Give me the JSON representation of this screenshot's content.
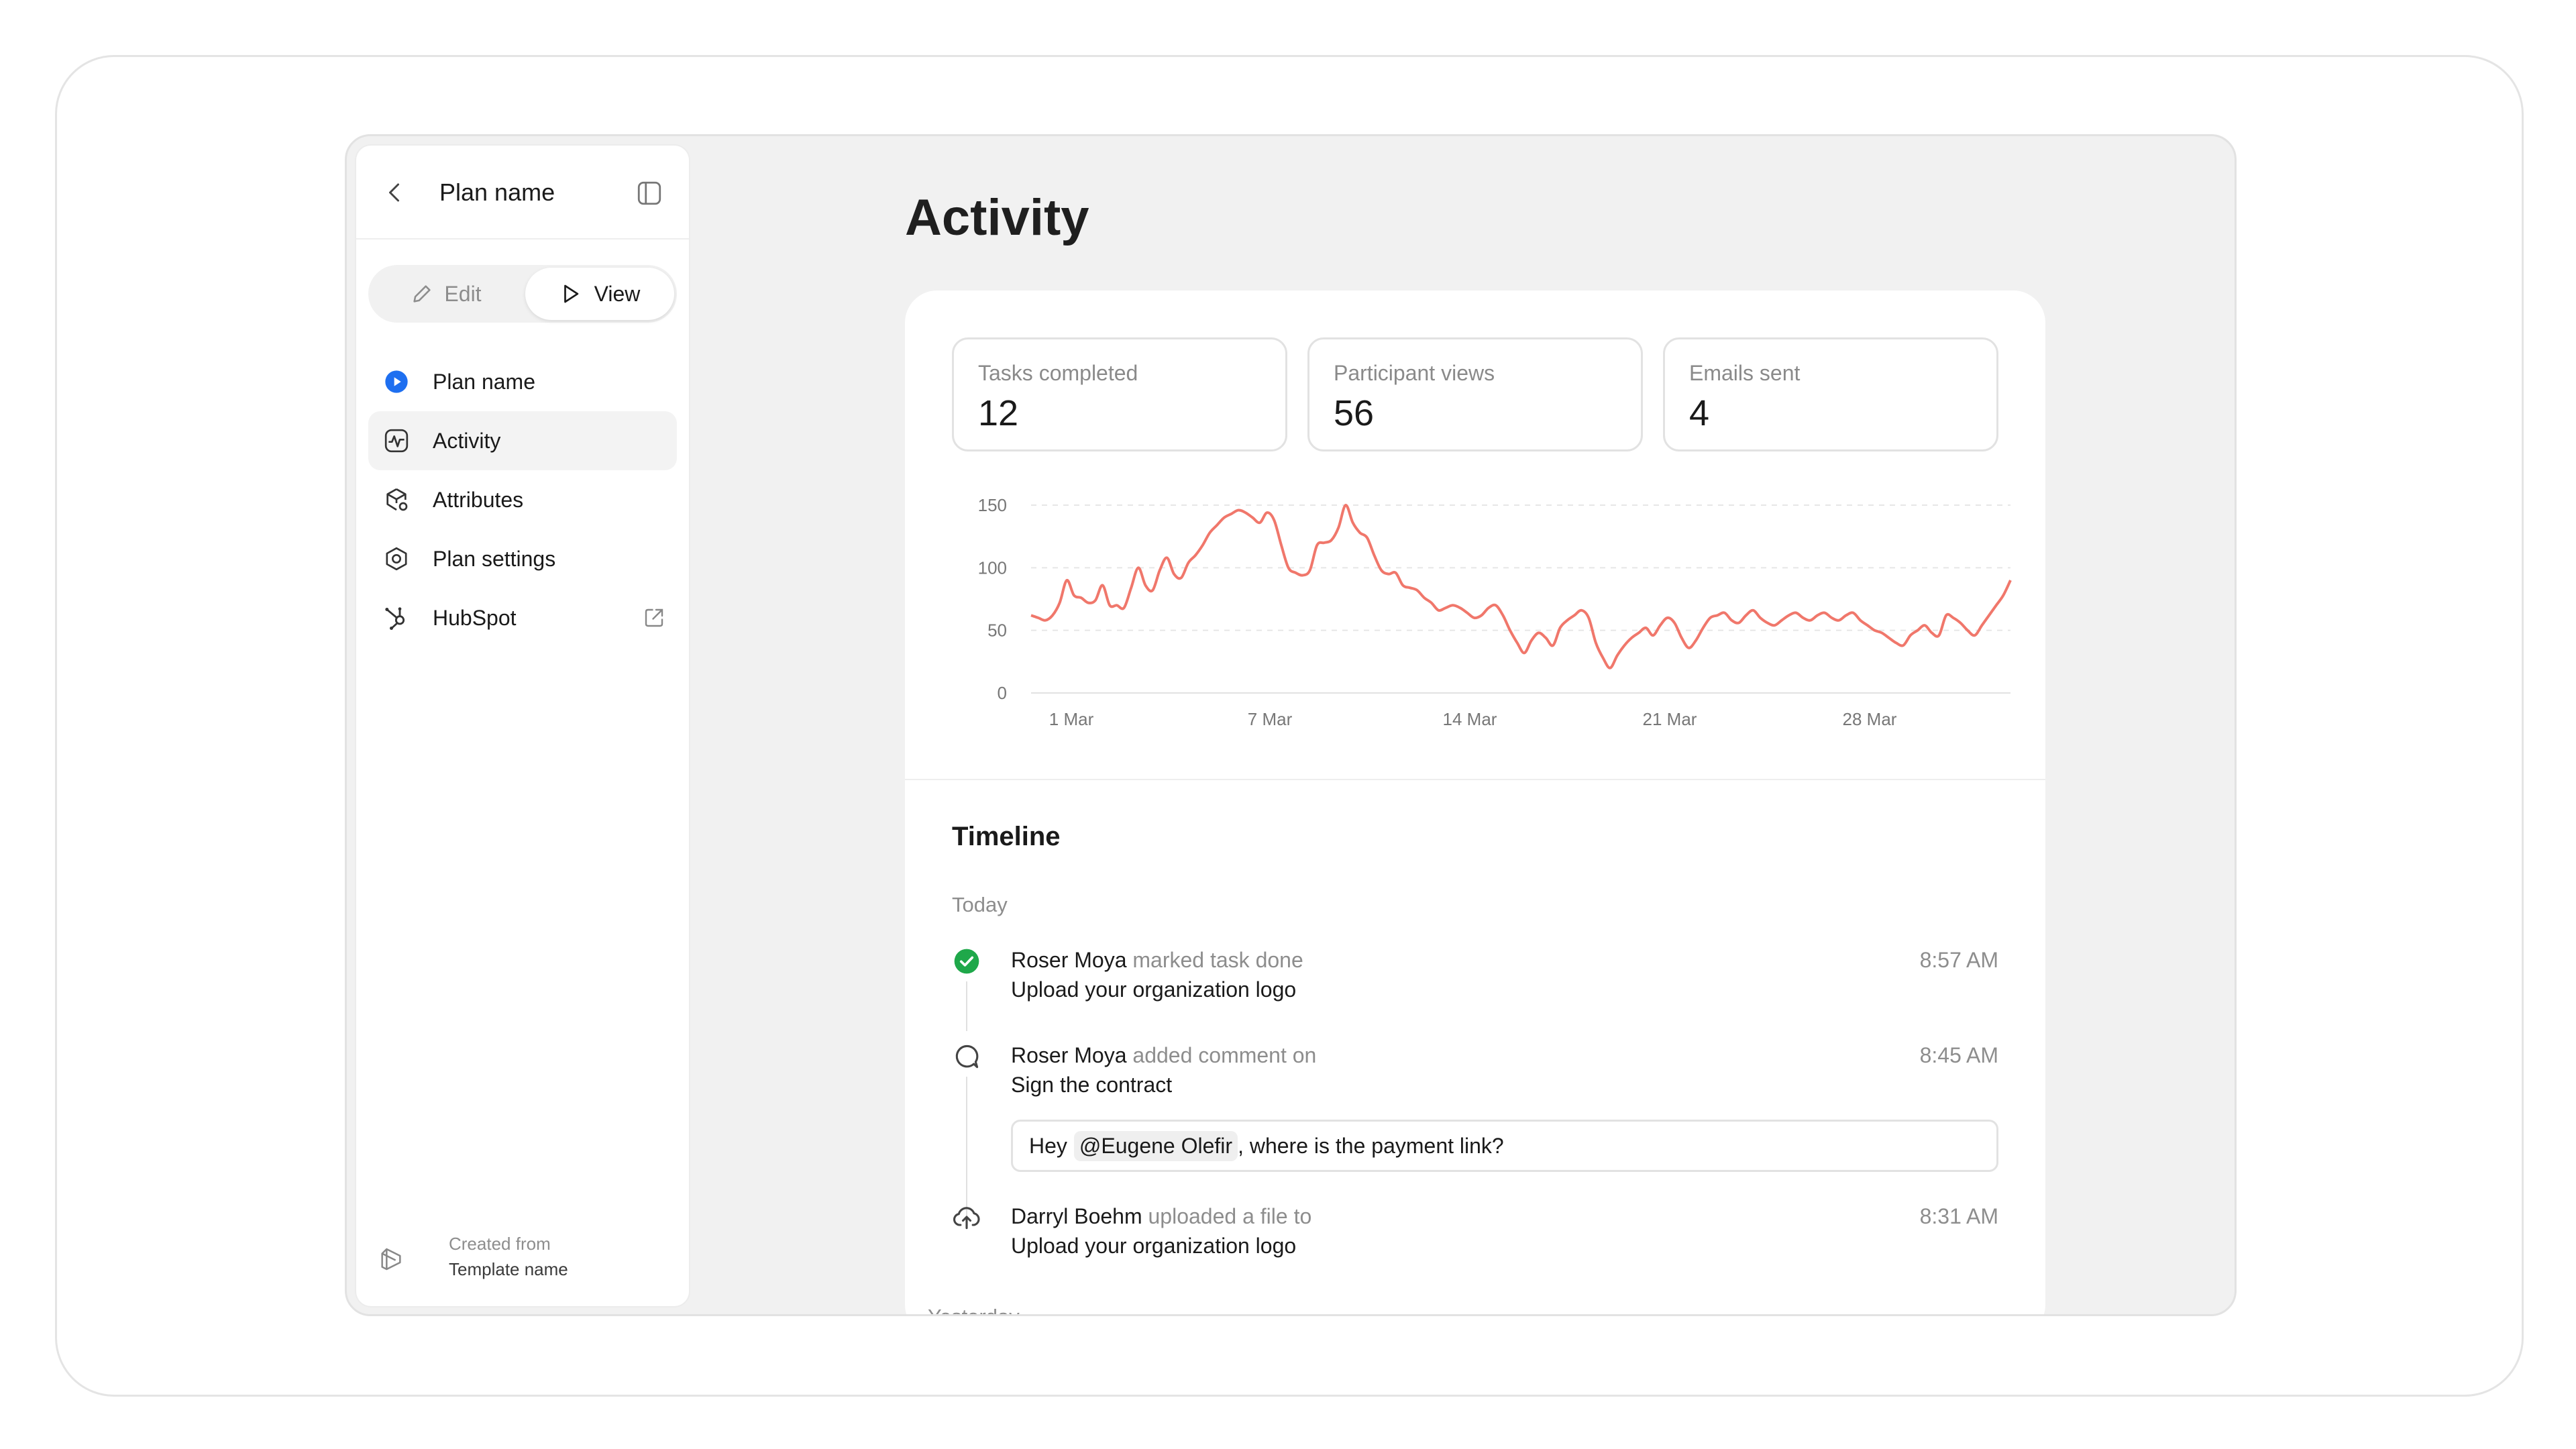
{
  "sidebar": {
    "title": "Plan name",
    "mode_edit": "Edit",
    "mode_view": "View",
    "items": [
      {
        "label": "Plan name"
      },
      {
        "label": "Activity"
      },
      {
        "label": "Attributes"
      },
      {
        "label": "Plan settings"
      },
      {
        "label": "HubSpot"
      }
    ],
    "created_from_label": "Created from",
    "template_name": "Template name"
  },
  "main": {
    "title": "Activity",
    "stats": [
      {
        "label": "Tasks completed",
        "value": "12"
      },
      {
        "label": "Participant views",
        "value": "56"
      },
      {
        "label": "Emails sent",
        "value": "4"
      }
    ]
  },
  "chart_data": {
    "type": "line",
    "title": "",
    "xlabel": "",
    "ylabel": "",
    "ylim": [
      0,
      150
    ],
    "yticks": [
      "0",
      "50",
      "100",
      "150"
    ],
    "xtick_labels": [
      "1 Mar",
      "7 Mar",
      "14 Mar",
      "21 Mar",
      "28 Mar"
    ],
    "grid": true,
    "line_color": "#f0776b",
    "series": [
      {
        "values": [
          62,
          60,
          58,
          62,
          72,
          90,
          78,
          76,
          72,
          74,
          86,
          70,
          70,
          68,
          84,
          100,
          86,
          82,
          98,
          108,
          95,
          92,
          104,
          110,
          118,
          128,
          134,
          140,
          143,
          146,
          144,
          140,
          136,
          144,
          138,
          118,
          100,
          96,
          94,
          98,
          118,
          120,
          122,
          132,
          150,
          136,
          128,
          124,
          110,
          98,
          95,
          96,
          86,
          84,
          82,
          76,
          72,
          66,
          68,
          70,
          68,
          64,
          60,
          62,
          68,
          70,
          62,
          50,
          40,
          32,
          42,
          48,
          44,
          38,
          52,
          58,
          62,
          66,
          60,
          40,
          28,
          20,
          30,
          38,
          44,
          48,
          52,
          46,
          54,
          60,
          56,
          44,
          36,
          42,
          52,
          60,
          62,
          64,
          58,
          56,
          62,
          66,
          60,
          56,
          54,
          58,
          62,
          64,
          60,
          58,
          62,
          64,
          60,
          58,
          62,
          64,
          58,
          54,
          50,
          48,
          44,
          40,
          38,
          46,
          50,
          54,
          48,
          46,
          62,
          60,
          56,
          50,
          46,
          54,
          62,
          70,
          78,
          90
        ]
      }
    ]
  },
  "timeline": {
    "title": "Timeline",
    "today_label": "Today",
    "yesterday_label": "Yesterday",
    "events": [
      {
        "actor": "Roser Moya",
        "action": "marked task done",
        "target": "Upload your organization logo",
        "time": "8:57 AM"
      },
      {
        "actor": "Roser Moya",
        "action": "added comment on",
        "target": "Sign the contract",
        "time": "8:45 AM",
        "comment_prefix": "Hey",
        "comment_mention": "@Eugene Olefir",
        "comment_suffix": ", where is the payment link?"
      },
      {
        "actor": "Darryl Boehm",
        "action": "uploaded a file to",
        "target": "Upload your organization logo",
        "time": "8:31 AM"
      }
    ]
  },
  "icons": {
    "back": "chevron-left-icon",
    "panel": "sidebar-panel-icon",
    "edit": "pencil-icon",
    "view": "play-icon",
    "plan": "play-circle-icon",
    "activity": "activity-pulse-icon",
    "attributes": "cube-settings-icon",
    "settings": "hexagon-gear-icon",
    "hubspot": "hubspot-icon",
    "external": "external-link-icon",
    "template": "layers-icon",
    "done": "check-circle-icon",
    "comment": "comment-icon",
    "upload": "cloud-upload-icon"
  },
  "colors": {
    "accent_blue": "#1e6ff0",
    "success_green": "#1fa84a",
    "chart_line": "#f0776b"
  }
}
